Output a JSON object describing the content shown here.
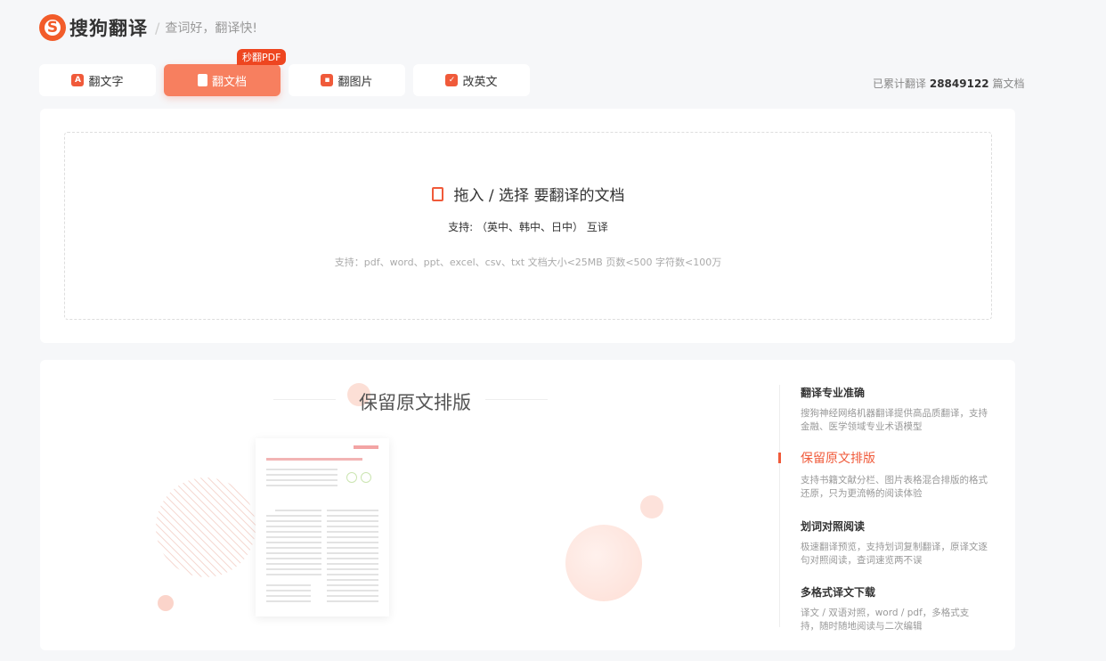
{
  "header": {
    "logo_letter": "S",
    "logo_text": "搜狗翻译",
    "separator": "/",
    "slogan": "查词好，翻译快!"
  },
  "tabs": [
    {
      "label": "翻文字",
      "icon": "text-translate-icon",
      "active": false
    },
    {
      "label": "翻文档",
      "icon": "document-icon",
      "active": true,
      "badge": "秒翻PDF"
    },
    {
      "label": "翻图片",
      "icon": "image-icon",
      "active": false
    },
    {
      "label": "改英文",
      "icon": "edit-check-icon",
      "active": false
    }
  ],
  "stats": {
    "prefix": "已累计翻译",
    "count": "28849122",
    "suffix": "篇文档"
  },
  "upload": {
    "title": "拖入 / 选择 要翻译的文档",
    "languages": "支持: （英中、韩中、日中） 互译",
    "note": "支持：pdf、word、ppt、excel、csv、txt    文档大小<25MB 页数<500 字符数<100万"
  },
  "showcase": {
    "title": "保留原文排版"
  },
  "features": [
    {
      "title": "翻译专业准确",
      "desc": "搜狗神经网络机器翻译提供高品质翻译，支持金融、医学领域专业术语模型",
      "active": false
    },
    {
      "title": "保留原文排版",
      "desc": "支持书籍文献分栏、图片表格混合排版的格式还原，只为更流畅的阅读体验",
      "active": true
    },
    {
      "title": "划词对照阅读",
      "desc": "极速翻译预览，支持划词复制翻译，原译文逐句对照阅读，查词速览两不误",
      "active": false
    },
    {
      "title": "多格式译文下载",
      "desc": "译文 / 双语对照，word / pdf，多格式支持，随时随地阅读与二次编辑",
      "active": false
    }
  ],
  "colors": {
    "accent": "#f05a3a",
    "active_tab": "#f77f5f",
    "background": "#f6f7f9"
  }
}
